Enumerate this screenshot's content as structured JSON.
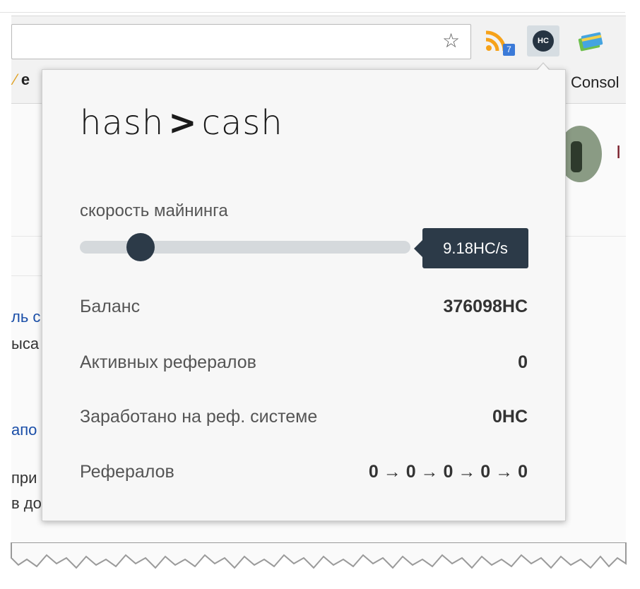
{
  "browser": {
    "bookmark_left": "e",
    "bookmark_right": "Consol",
    "rss_badge": "7",
    "active_extension": "HC"
  },
  "page_fragments": {
    "name": "I",
    "f1": "ль с",
    "f2": "ыса",
    "f3": "апо",
    "f4": "при",
    "f5": "в до"
  },
  "popup": {
    "logo_left": "hash",
    "logo_sep": ">",
    "logo_right": "cash",
    "speed_label": "скорость майнинга",
    "speed_value": "9.18HC/s",
    "speed_level_fraction": 0.18,
    "stats": {
      "balance_label": "Баланс",
      "balance_value": "376098HC",
      "active_refs_label": "Активных рефералов",
      "active_refs_value": "0",
      "earned_label": "Заработано на реф. системе",
      "earned_value": "0HC",
      "refs_label": "Рефералов",
      "refs_value": "0 → 0 → 0 → 0 → 0"
    }
  },
  "colors": {
    "accent": "#2c3a48",
    "track": "#d5d9dc",
    "link": "#1a4ea8",
    "rss": "#f6a21a",
    "badge": "#3b7ad8"
  },
  "icons": [
    "star-icon",
    "rss-icon",
    "hashcash-icon",
    "payment-icon"
  ]
}
